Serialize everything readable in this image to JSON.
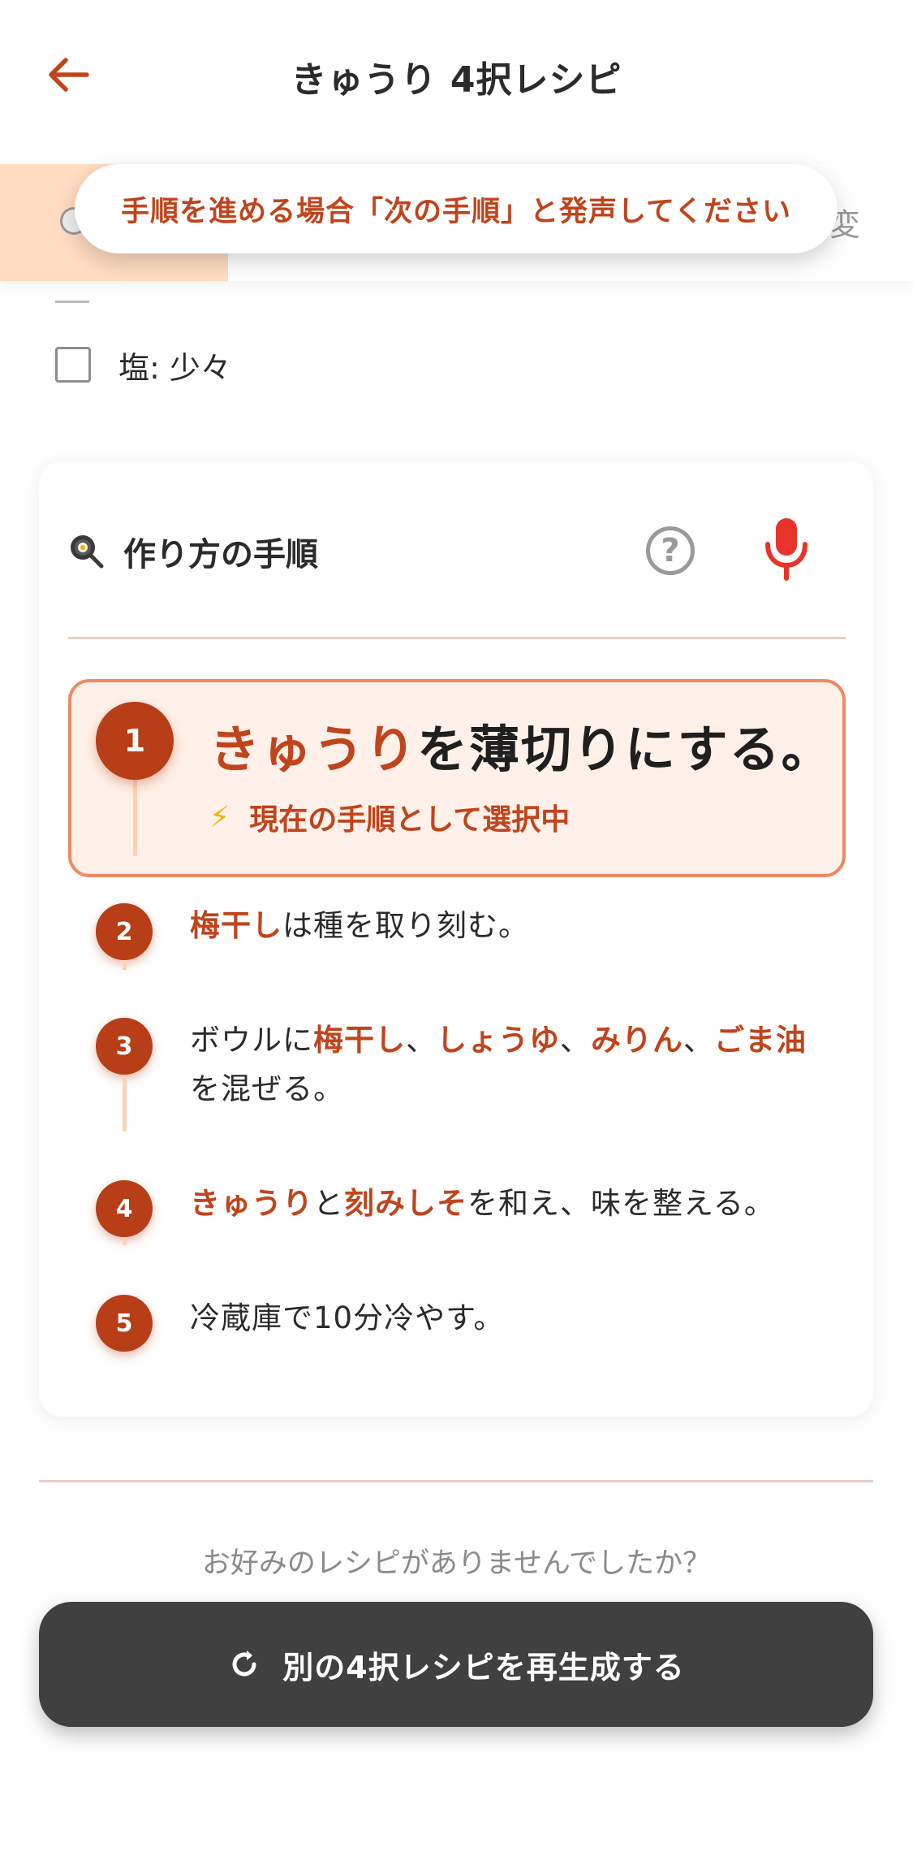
{
  "header": {
    "title": "きゅうり 4択レシピ"
  },
  "toast": {
    "text": "手順を進める場合「次の手順」と発声してください"
  },
  "tabs": {
    "right_partial": "変"
  },
  "ingredients": {
    "items": [
      {
        "label": "塩: 少々",
        "checked": false
      }
    ]
  },
  "steps_card": {
    "title": "作り方の手順",
    "help_icon": "question-circle-icon",
    "mic_icon": "microphone-icon",
    "current_step_note": "現在の手順として選択中",
    "steps": [
      {
        "number": "1",
        "parts": [
          {
            "t": "きゅうり",
            "hl": true
          },
          {
            "t": "を薄切りにする。",
            "hl": false
          }
        ]
      },
      {
        "number": "2",
        "parts": [
          {
            "t": "梅干し",
            "hl": true
          },
          {
            "t": "は種を取り刻む。",
            "hl": false
          }
        ]
      },
      {
        "number": "3",
        "parts": [
          {
            "t": "ボウルに",
            "hl": false
          },
          {
            "t": "梅干し",
            "hl": true
          },
          {
            "t": "、",
            "hl": false
          },
          {
            "t": "しょうゆ",
            "hl": true
          },
          {
            "t": "、",
            "hl": false
          },
          {
            "t": "みりん",
            "hl": true
          },
          {
            "t": "、",
            "hl": false
          },
          {
            "t": "ごま油",
            "hl": true
          },
          {
            "t": "を混ぜる。",
            "hl": false
          }
        ]
      },
      {
        "number": "4",
        "parts": [
          {
            "t": "きゅうり",
            "hl": true
          },
          {
            "t": "と",
            "hl": false
          },
          {
            "t": "刻みしそ",
            "hl": true
          },
          {
            "t": "を和え、味を整える。",
            "hl": false
          }
        ]
      },
      {
        "number": "5",
        "parts": [
          {
            "t": "冷蔵庫で10分冷やす。",
            "hl": false
          }
        ]
      }
    ]
  },
  "footer": {
    "question": "お好みのレシピがありませんでしたか？",
    "regenerate_label": "別の4択レシピを再生成する"
  },
  "colors": {
    "accent": "#c0441c",
    "step_badge": "#b83e17",
    "highlight_bg": "#fff1e9",
    "tab_active": "#ffdcc2",
    "button_dark": "#404040"
  }
}
